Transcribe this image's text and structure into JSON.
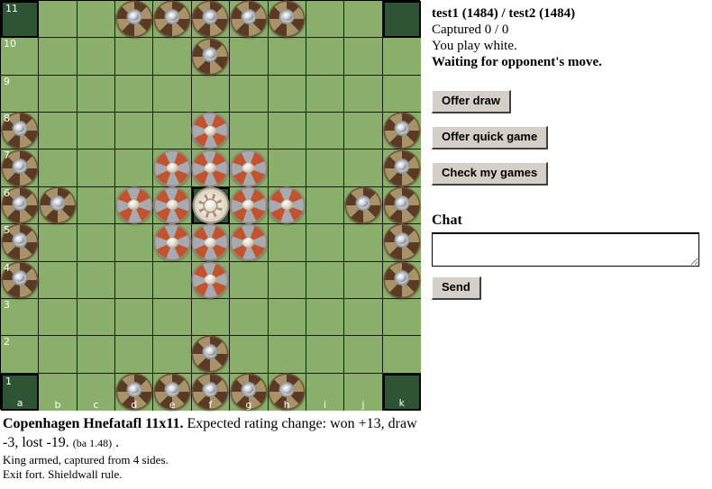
{
  "board": {
    "size": 11,
    "files": [
      "a",
      "b",
      "c",
      "d",
      "e",
      "f",
      "g",
      "h",
      "i",
      "j",
      "k"
    ],
    "ranks": [
      "11",
      "10",
      "9",
      "8",
      "7",
      "6",
      "5",
      "4",
      "3",
      "2",
      "1"
    ],
    "colors": {
      "square": "#8aaf6a",
      "corner": "#2d5434",
      "throne": "#2d5434",
      "grid_line": "#1a1a1a"
    },
    "special_squares": [
      "a11",
      "k11",
      "a1",
      "k1",
      "f6"
    ],
    "throne": "f6",
    "pieces": {
      "attacker": [
        "d11",
        "e11",
        "f11",
        "g11",
        "h11",
        "f10",
        "a8",
        "k8",
        "a7",
        "k7",
        "a6",
        "b6",
        "j6",
        "k6",
        "a5",
        "k5",
        "a4",
        "k4",
        "f2",
        "d1",
        "e1",
        "f1",
        "g1",
        "h1"
      ],
      "defender": [
        "f8",
        "e7",
        "f7",
        "g7",
        "d6",
        "e6",
        "g6",
        "h6",
        "e5",
        "f5",
        "g5",
        "f4"
      ],
      "king": [
        "f6"
      ]
    }
  },
  "side": {
    "players": "test1 (1484) / test2 (1484)",
    "captured": "Captured  0 / 0",
    "side_note": "You play white.",
    "status": "Waiting for opponent's move.",
    "offer_draw_label": "Offer draw",
    "offer_quick_game_label": "Offer quick game",
    "check_games_label": "Check my games",
    "chat_heading": "Chat",
    "chat_value": "",
    "chat_placeholder": "",
    "send_label": "Send"
  },
  "info": {
    "variant": "Copenhagen Hnefatafl 11x11.",
    "rating_text": "Expected rating change: won +13, draw -3, lost -19.",
    "ba": "(ba 1.48)",
    "period": ".",
    "rule1": "King armed, captured from 4 sides.",
    "rule2": "Exit fort. Shieldwall rule."
  }
}
